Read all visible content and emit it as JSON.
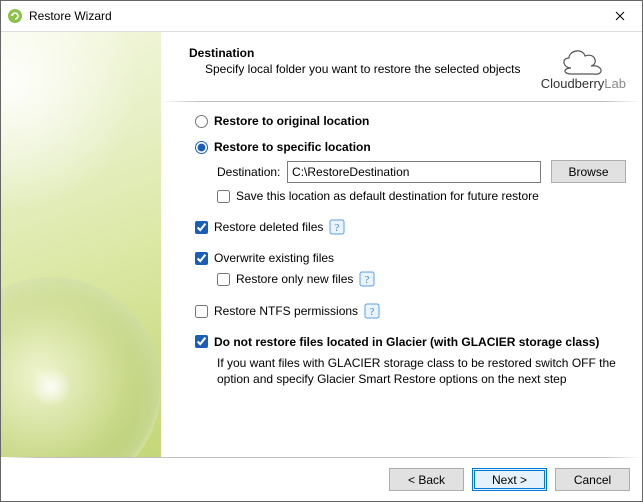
{
  "window": {
    "title": "Restore Wizard"
  },
  "header": {
    "title": "Destination",
    "subtitle": "Specify local folder you want to restore the selected objects",
    "brand": "Cloudberry",
    "brand_suffix": "Lab"
  },
  "options": {
    "restore_original_label": "Restore to original location",
    "restore_specific_label": "Restore to specific location",
    "destination_label": "Destination:",
    "destination_value": "C:\\RestoreDestination",
    "browse_label": "Browse",
    "save_default_label": "Save this location as default destination for future restore",
    "restore_deleted_label": "Restore deleted files",
    "overwrite_label": "Overwrite existing files",
    "restore_only_new_label": "Restore only new files",
    "restore_ntfs_label": "Restore NTFS permissions",
    "glacier_label": "Do not restore files located in Glacier (with GLACIER storage class)",
    "glacier_note": "If you want files with GLACIER storage class to be restored switch OFF the option and specify Glacier Smart Restore options on the next step",
    "restore_mode": "specific",
    "save_default": false,
    "restore_deleted": true,
    "overwrite": true,
    "restore_only_new": false,
    "restore_ntfs": false,
    "glacier_skip": true
  },
  "footer": {
    "back": "< Back",
    "next": "Next >",
    "cancel": "Cancel"
  }
}
